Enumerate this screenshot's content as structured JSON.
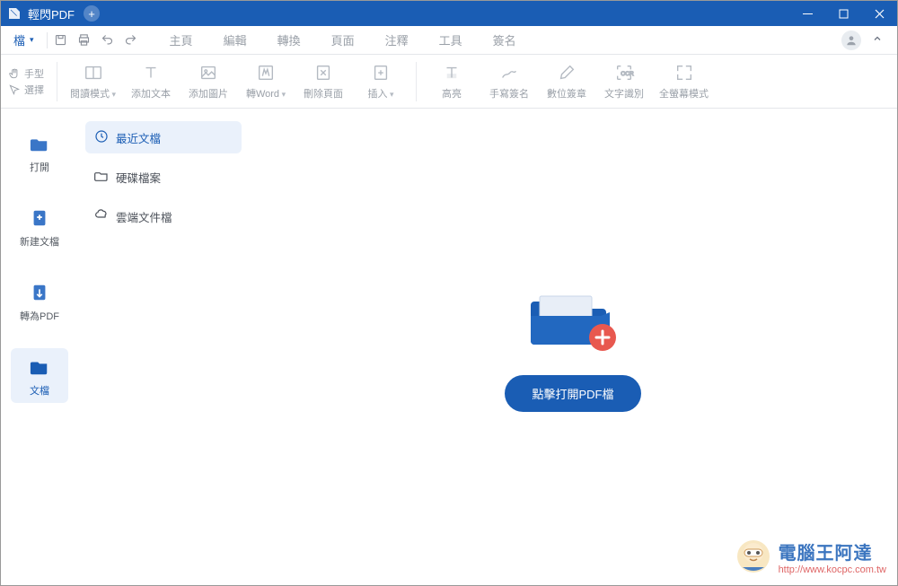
{
  "titlebar": {
    "app_name": "輕閃PDF"
  },
  "menubar": {
    "file_label": "檔",
    "tabs": [
      "主頁",
      "編輯",
      "轉換",
      "頁面",
      "注釋",
      "工具",
      "簽名"
    ]
  },
  "ribbon_left": {
    "hand": "手型",
    "select": "選擇"
  },
  "ribbon": [
    {
      "label": "閱讀模式",
      "caret": true
    },
    {
      "label": "添加文本"
    },
    {
      "label": "添加圖片"
    },
    {
      "label": "轉Word",
      "caret": true
    },
    {
      "label": "刪除頁面"
    },
    {
      "label": "插入",
      "caret": true
    },
    {
      "label": "高亮"
    },
    {
      "label": "手寫簽名"
    },
    {
      "label": "數位簽章"
    },
    {
      "label": "文字識別"
    },
    {
      "label": "全螢幕模式"
    }
  ],
  "sidebar": [
    {
      "label": "打開"
    },
    {
      "label": "新建文檔"
    },
    {
      "label": "轉為PDF"
    },
    {
      "label": "文檔"
    }
  ],
  "subpanel": [
    {
      "label": "最近文檔"
    },
    {
      "label": "硬碟檔案"
    },
    {
      "label": "雲端文件檔"
    }
  ],
  "content": {
    "open_button": "點擊打開PDF檔"
  },
  "watermark": {
    "name": "電腦王阿達",
    "url": "http://www.kocpc.com.tw"
  }
}
